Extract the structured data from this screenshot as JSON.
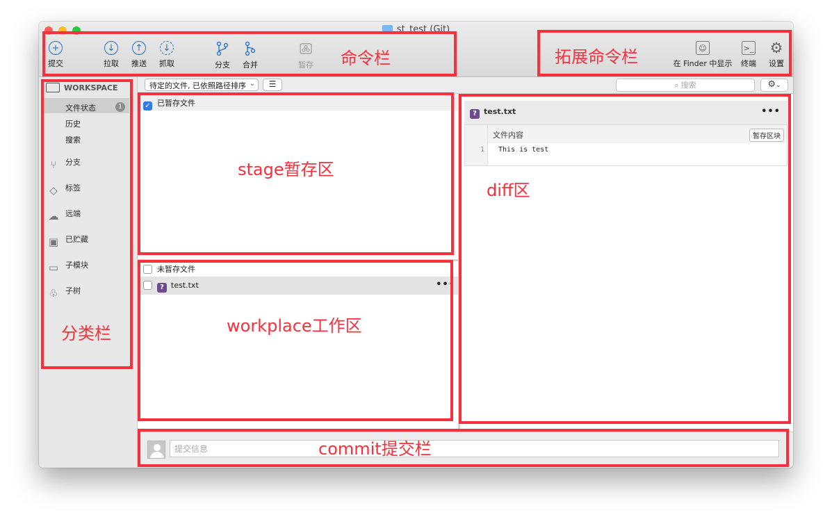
{
  "window": {
    "title": "st_test (Git)"
  },
  "toolbar": {
    "commit": "提交",
    "pull": "拉取",
    "push": "推送",
    "fetch": "抓取",
    "branch": "分支",
    "merge": "合并",
    "stash": "暂存",
    "show_in_finder": "在 Finder 中显示",
    "terminal": "终端",
    "settings": "设置"
  },
  "subbar": {
    "sort_select": "待定的文件, 已依照路径排序",
    "search_placeholder": "搜索"
  },
  "sidebar": {
    "workspace": "WORKSPACE",
    "file_status": "文件状态",
    "file_status_count": "1",
    "history": "历史",
    "search": "搜索",
    "items": [
      {
        "label": "分支",
        "icon": "branch-icon"
      },
      {
        "label": "标签",
        "icon": "tag-icon"
      },
      {
        "label": "远端",
        "icon": "cloud-icon"
      },
      {
        "label": "已贮藏",
        "icon": "stash-icon"
      },
      {
        "label": "子模块",
        "icon": "submodule-icon"
      },
      {
        "label": "子树",
        "icon": "subtree-icon"
      }
    ]
  },
  "stage": {
    "header": "已暂存文件"
  },
  "work": {
    "header": "未暂存文件",
    "files": [
      {
        "name": "test.txt",
        "status": "?"
      }
    ]
  },
  "diff": {
    "filename": "test.txt",
    "file_status": "?",
    "hunk_title": "文件内容",
    "hunk_button": "暂存区块",
    "lines": [
      {
        "no": "1",
        "text": "This is test"
      }
    ]
  },
  "commit": {
    "placeholder": "提交信息"
  },
  "annotations": {
    "command_bar": "命令栏",
    "ext_command_bar": "拓展命令栏",
    "category_bar": "分类栏",
    "stage_area": "stage暂存区",
    "workplace_area": "workplace工作区",
    "diff_area": "diff区",
    "commit_bar": "commit提交栏"
  },
  "colors": {
    "annotation": "#f5313d",
    "accent": "#2a74c9",
    "file_badge": "#6c4a8d"
  }
}
